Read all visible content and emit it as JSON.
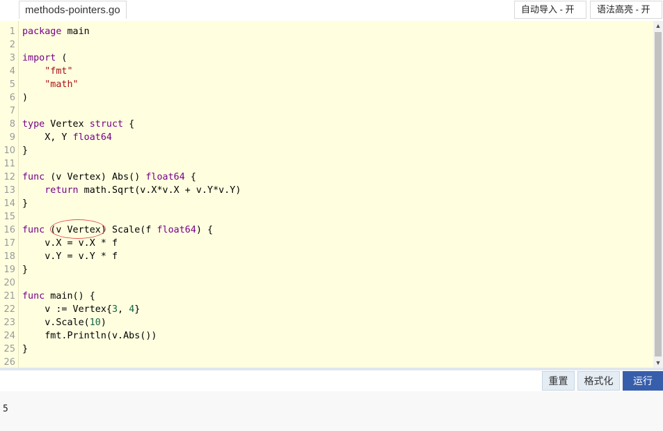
{
  "file_tab": {
    "name": "methods-pointers.go"
  },
  "toolbar": {
    "imports_toggle": "自动导入 - 开",
    "syntax_toggle": "语法高亮 - 开"
  },
  "editor": {
    "line_numbers": [
      "1",
      "2",
      "3",
      "4",
      "5",
      "6",
      "7",
      "8",
      "9",
      "10",
      "11",
      "12",
      "13",
      "14",
      "15",
      "16",
      "17",
      "18",
      "19",
      "20",
      "21",
      "22",
      "23",
      "24",
      "25",
      "26"
    ],
    "code_lines": [
      "package main",
      "",
      "import (",
      "\t\"fmt\"",
      "\t\"math\"",
      ")",
      "",
      "type Vertex struct {",
      "\tX, Y float64",
      "}",
      "",
      "func (v Vertex) Abs() float64 {",
      "\treturn math.Sqrt(v.X*v.X + v.Y*v.Y)",
      "}",
      "",
      "func (v Vertex) Scale(f float64) {",
      "\tv.X = v.X * f",
      "\tv.Y = v.Y * f",
      "}",
      "",
      "func main() {",
      "\tv := Vertex{3, 4}",
      "\tv.Scale(10)",
      "\tfmt.Println(v.Abs())",
      "}",
      ""
    ]
  },
  "buttons": {
    "reset": "重置",
    "format": "格式化",
    "run": "运行"
  },
  "output": {
    "text": "5"
  },
  "colors": {
    "editor_bg": "#ffffe0",
    "keyword": "#770088",
    "string": "#aa1111",
    "number": "#116644",
    "run_button": "#375eab",
    "annotation": "#e05050"
  }
}
